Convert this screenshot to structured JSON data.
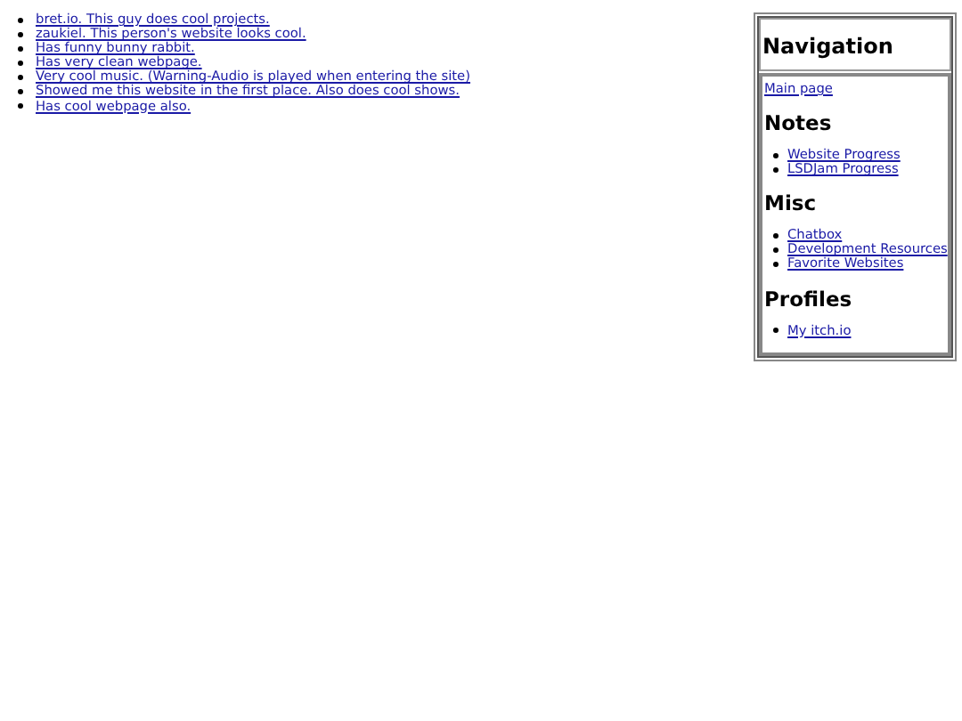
{
  "links": [
    "bret.io. This guy does cool projects.",
    "zaukiel. This person's website looks cool.",
    "Has funny bunny rabbit.",
    "Has very clean webpage.",
    "Very cool music. (Warning-Audio is played when entering the site)",
    "Showed me this website in the first place. Also does cool shows.",
    "Has cool webpage also."
  ],
  "sidebar": {
    "title": "Navigation",
    "main_link": "Main page",
    "sections": [
      {
        "heading": "Notes",
        "items": [
          "Website Progress",
          "LSDJam Progress"
        ]
      },
      {
        "heading": "Misc",
        "items": [
          "Chatbox",
          "Development Resources",
          "Favorite Websites"
        ]
      },
      {
        "heading": "Profiles",
        "items": [
          "My itch.io"
        ]
      }
    ]
  }
}
